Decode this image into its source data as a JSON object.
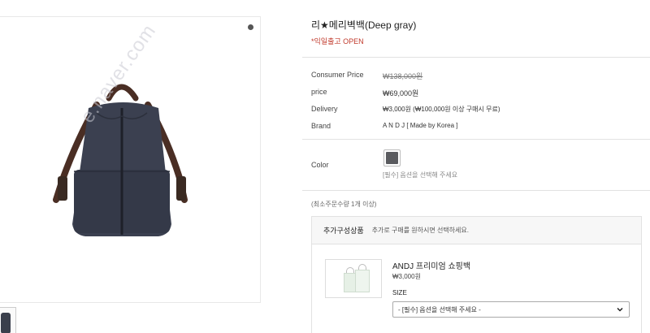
{
  "gallery": {
    "watermark": "e.naver.com"
  },
  "product": {
    "title": "리★메리벽백(Deep gray)",
    "notice": "*익일출고 OPEN"
  },
  "specs": [
    {
      "label": "Consumer Price",
      "value": "₩138,000원"
    },
    {
      "label": "price",
      "value": "₩69,000원"
    },
    {
      "label": "Delivery",
      "value": "₩3,000원 (₩100,000원 이상 구매시 무료)"
    },
    {
      "label": "Brand",
      "value": "A N D J [ Made by Korea ]"
    }
  ],
  "color": {
    "label": "Color",
    "swatch_color": "#5a5b5f",
    "hint": "[필수] 옵션을 선택해 주세요"
  },
  "min_qty": "(최소주문수량 1개 이상)",
  "addon": {
    "title": "추가구성상품",
    "subtitle": "추가로 구매를 원하시면 선택하세요.",
    "item": {
      "name": "ANDJ 프리미엄 쇼핑백",
      "price": "₩3,000원",
      "size_label": "SIZE",
      "select_value": "- [필수] 옵션을 선택해 주세요 -"
    }
  }
}
